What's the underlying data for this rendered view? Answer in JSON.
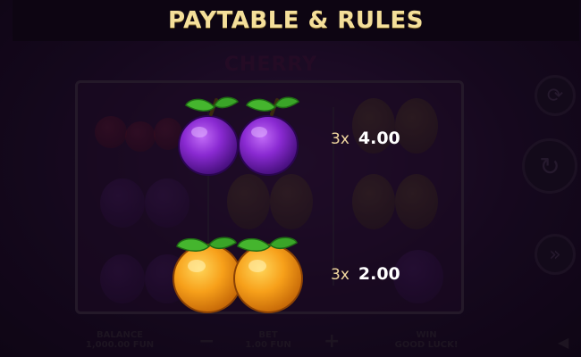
{
  "header": {
    "title": "PAYTABLE & RULES"
  },
  "background_game": {
    "logo_text": "CHERRY",
    "bottom_bar": {
      "balance_label": "BALANCE",
      "balance_value": "1,000.00 FUN",
      "bet_label": "BET",
      "bet_value": "1.00 FUN",
      "win_label": "WIN",
      "win_value": "GOOD LUCK!",
      "minus_glyph": "−",
      "plus_glyph": "+"
    }
  },
  "paytable": [
    {
      "symbol": "plum",
      "count": "3x",
      "payout": "4.00",
      "colors": {
        "body": "#7b22c4",
        "highlight": "#b05cf0",
        "leaf": "#3fae2a"
      }
    },
    {
      "symbol": "orange",
      "count": "3x",
      "payout": "2.00",
      "colors": {
        "body": "#f39a12",
        "highlight": "#ffd04a",
        "leaf": "#3fae2a"
      }
    }
  ],
  "colors": {
    "title": "#f4df9a",
    "header_bg": "#0d0512"
  }
}
